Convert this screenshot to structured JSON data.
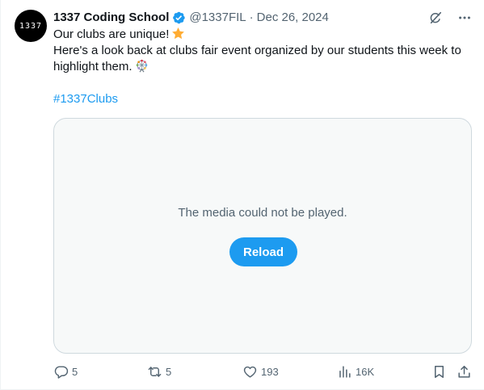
{
  "author": {
    "avatar_text": "1337",
    "name": "1337 Coding School",
    "handle": "@1337FIL",
    "separator": "·",
    "date": "Dec 26, 2024"
  },
  "tweet": {
    "line1": "Our clubs are unique!",
    "line2": "Here's a look back at clubs fair event organized by our students this week to",
    "line3": "highlight them.",
    "hashtag": "#1337Clubs"
  },
  "media": {
    "message": "The media could not be played.",
    "reload_label": "Reload"
  },
  "actions": {
    "replies": "5",
    "reposts": "5",
    "likes": "193",
    "views": "16K"
  },
  "colors": {
    "accent": "#1d9bf0",
    "muted": "#536471",
    "text": "#0f1419",
    "media_bg": "#f7f9f9"
  },
  "icons": {
    "verified": "verified-badge-icon",
    "grok": "grok-icon",
    "more": "more-options-icon",
    "star": "star-emoji",
    "ferris_wheel": "ferris-wheel-emoji",
    "reply": "reply-icon",
    "repost": "repost-icon",
    "like": "heart-icon",
    "views": "analytics-icon",
    "bookmark": "bookmark-icon",
    "share": "share-icon"
  }
}
